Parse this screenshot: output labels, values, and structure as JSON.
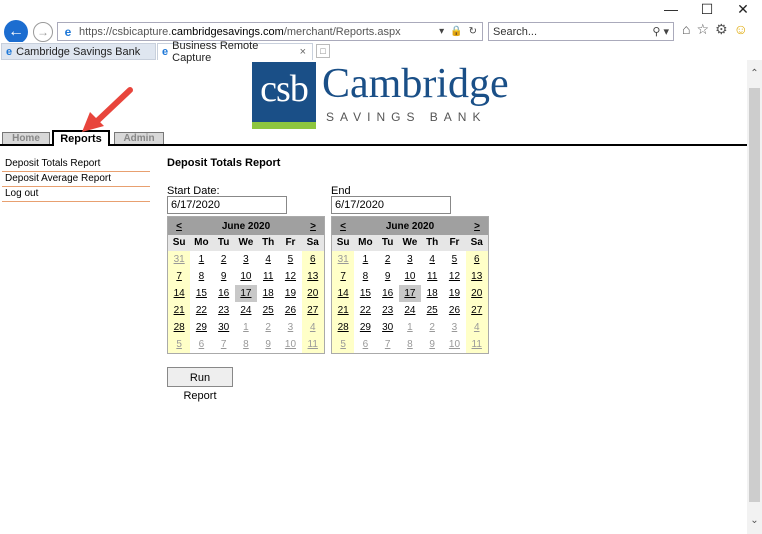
{
  "browser": {
    "url_prefix": "https://csbicapture.",
    "url_host": "cambridgesavings.com",
    "url_path": "/merchant/Reports.aspx",
    "search_placeholder": "Search...",
    "tabs": [
      {
        "label": "Cambridge Savings Bank"
      },
      {
        "label": "Business Remote Capture"
      }
    ],
    "tab_close": "×"
  },
  "logo": {
    "mark": "csb",
    "name": "Cambridge",
    "subtitle": "SAVINGS BANK",
    "colors": {
      "blue": "#1a4f87",
      "green": "#8dc63f"
    }
  },
  "nav": {
    "tabs": [
      {
        "label": "Home",
        "active": false
      },
      {
        "label": "Reports",
        "active": true
      },
      {
        "label": "Admin",
        "active": false
      }
    ]
  },
  "sidebar": {
    "items": [
      {
        "label": "Deposit Totals Report"
      },
      {
        "label": "Deposit Average Report"
      },
      {
        "label": "Log out"
      }
    ]
  },
  "report": {
    "title": "Deposit Totals Report",
    "start_label": "Start Date:",
    "start_value": "6/17/2020",
    "end_label": "End Date:",
    "end_value": "6/17/2020",
    "run_label": "Run Report"
  },
  "calendar": {
    "prev": "<",
    "next": ">",
    "month": "June 2020",
    "dows": [
      "Su",
      "Mo",
      "Tu",
      "We",
      "Th",
      "Fr",
      "Sa"
    ],
    "weeks": [
      [
        "31",
        "1",
        "2",
        "3",
        "4",
        "5",
        "6"
      ],
      [
        "7",
        "8",
        "9",
        "10",
        "11",
        "12",
        "13"
      ],
      [
        "14",
        "15",
        "16",
        "17",
        "18",
        "19",
        "20"
      ],
      [
        "21",
        "22",
        "23",
        "24",
        "25",
        "26",
        "27"
      ],
      [
        "28",
        "29",
        "30",
        "1",
        "2",
        "3",
        "4"
      ],
      [
        "5",
        "6",
        "7",
        "8",
        "9",
        "10",
        "11"
      ]
    ],
    "selected": "17",
    "colors": {
      "header": "#a0a0a0",
      "weekend": "#ffffc8",
      "selected": "#c8c8c8"
    }
  },
  "annotation": {
    "arrow_color": "#e8453c"
  }
}
